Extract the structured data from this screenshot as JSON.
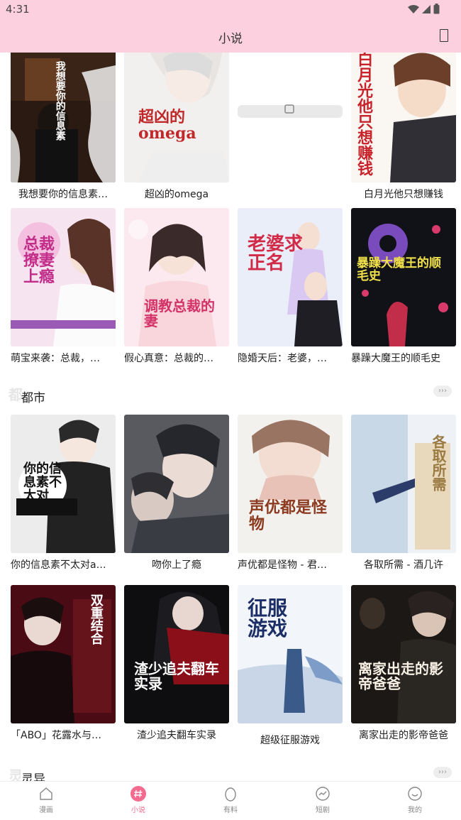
{
  "status_bar": {
    "time": "4:31"
  },
  "header": {
    "title": "小说"
  },
  "sections": [
    {
      "title": "都市",
      "ghost": "都",
      "more": "›››"
    },
    {
      "title": "灵异",
      "ghost": "灵",
      "more": "›››"
    }
  ],
  "books_top": [
    {
      "title": "我想要你的信息素…",
      "cover_text": "我想要你的信息素"
    },
    {
      "title": "超凶的omega",
      "cover_text": "超凶的omega"
    },
    {
      "title": "",
      "cover_text": ""
    },
    {
      "title": "白月光他只想赚钱",
      "cover_text": "白月光他只想赚钱"
    },
    {
      "title": "萌宝来袭：总裁，…",
      "cover_text": "总裁撩妻上瘾"
    },
    {
      "title": "假心真意：总裁的…",
      "cover_text": "调教总裁的妻"
    },
    {
      "title": "隐婚天后：老婆，…",
      "cover_text": "老婆求正名"
    },
    {
      "title": "暴躁大魔王的顺毛史",
      "cover_text": "暴躁大魔王的顺毛史"
    }
  ],
  "books_city": [
    {
      "title": "你的信息素不太对a…",
      "cover_text": "你的信息素不太对"
    },
    {
      "title": "吻你上了瘾",
      "cover_text": ""
    },
    {
      "title": "声优都是怪物 - 君…",
      "cover_text": "声优都是怪物"
    },
    {
      "title": "各取所需 - 酒几许",
      "cover_text": "各取所需"
    },
    {
      "title": "「ABO」花露水与…",
      "cover_text": "双重结合"
    },
    {
      "title": "渣少追夫翻车实录",
      "cover_text": "渣少追夫翻车实录"
    },
    {
      "title": "超级征服游戏",
      "cover_text": "征服游戏"
    },
    {
      "title": "离家出走的影帝爸爸",
      "cover_text": "离家出走的影帝爸爸"
    }
  ],
  "tabs": [
    {
      "label": "漫画",
      "icon": "home-icon",
      "active": false
    },
    {
      "label": "小说",
      "icon": "hash-icon",
      "active": true
    },
    {
      "label": "有料",
      "icon": "egg-icon",
      "active": false
    },
    {
      "label": "短剧",
      "icon": "trend-icon",
      "active": false
    },
    {
      "label": "我的",
      "icon": "smile-icon",
      "active": false
    }
  ],
  "colors": {
    "accent": "#f56a8f",
    "header_bg": "#fdd0e0"
  }
}
